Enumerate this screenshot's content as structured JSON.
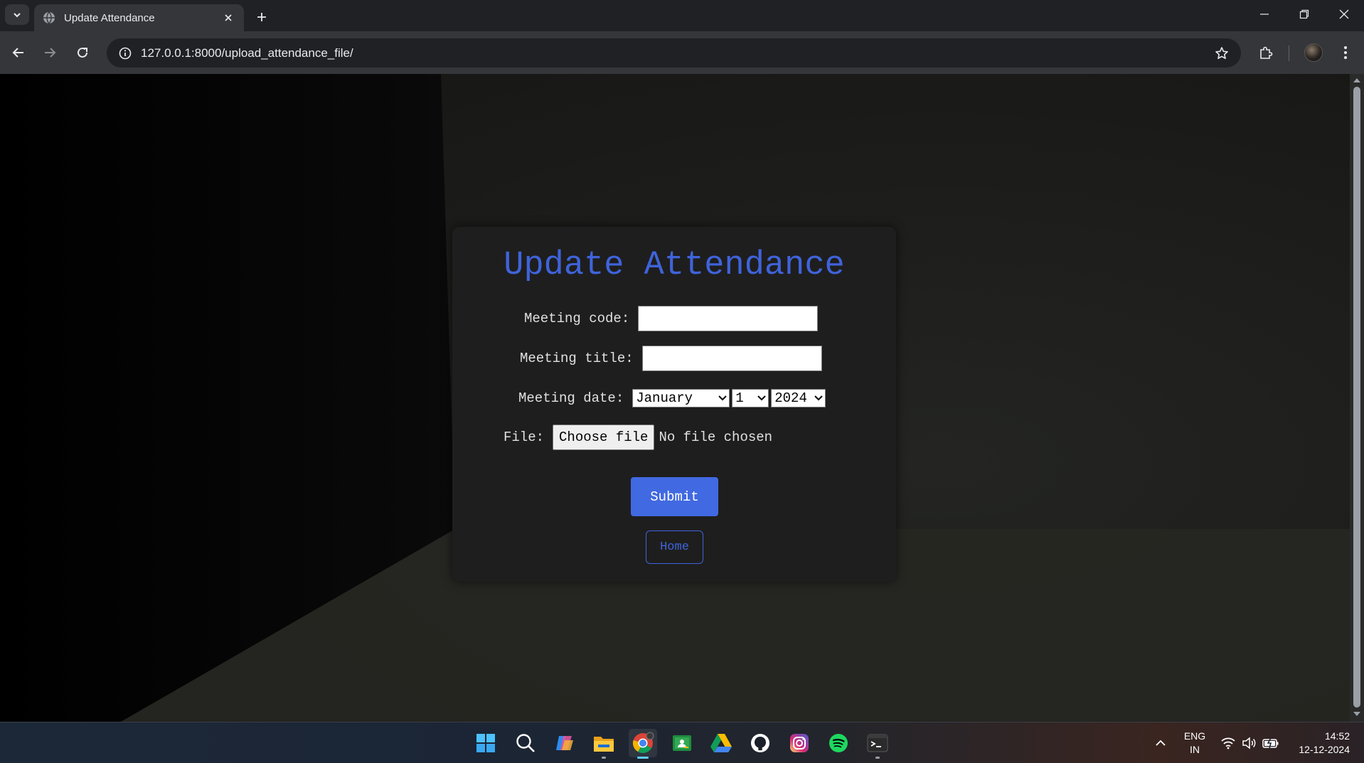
{
  "browser": {
    "tab_title": "Update Attendance",
    "url": "127.0.0.1:8000/upload_attendance_file/"
  },
  "form": {
    "heading": "Update Attendance",
    "meeting_code_label": "Meeting code:",
    "meeting_code_value": "",
    "meeting_title_label": "Meeting title:",
    "meeting_title_value": "",
    "meeting_date_label": "Meeting date:",
    "month_selected": "January",
    "day_selected": "1",
    "year_selected": "2024",
    "file_label": "File:",
    "choose_file_label": "Choose file",
    "no_file_text": "No file chosen",
    "submit_label": "Submit",
    "home_label": "Home"
  },
  "colors": {
    "accent": "#4169e1",
    "heading": "#3f63db",
    "card_bg": "#1e1e1e"
  },
  "taskbar": {
    "icons": [
      "windows-start-icon",
      "search-icon",
      "copilot-icon",
      "file-explorer-icon",
      "chrome-icon",
      "google-classroom-icon",
      "google-drive-icon",
      "github-icon",
      "instagram-icon",
      "spotify-icon",
      "terminal-icon"
    ],
    "language_line1": "ENG",
    "language_line2": "IN",
    "time": "14:52",
    "date": "12-12-2024"
  }
}
